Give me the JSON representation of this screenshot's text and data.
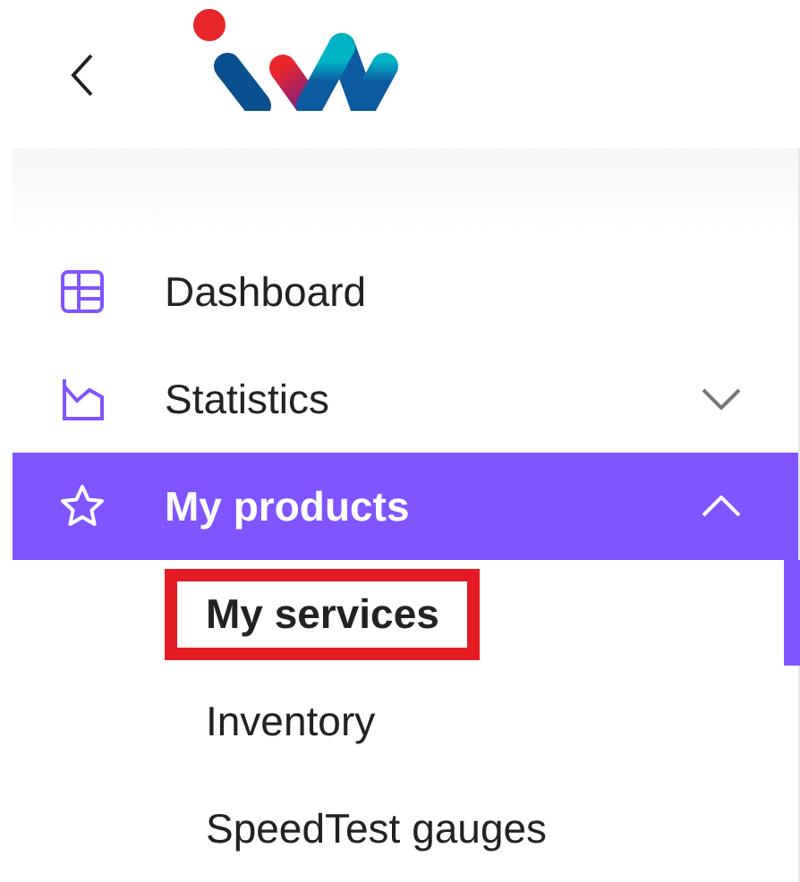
{
  "menu": [
    {
      "label": "Dashboard",
      "kind": "dashboard",
      "selected": false
    },
    {
      "label": "Statistics",
      "kind": "chart",
      "selected": false,
      "expanded": false
    },
    {
      "label": "My products",
      "kind": "star",
      "selected": true,
      "expanded": true,
      "children": [
        {
          "label": "My services",
          "selected": true,
          "highlighted": true
        },
        {
          "label": "Inventory",
          "selected": false,
          "highlighted": false
        },
        {
          "label": "SpeedTest gauges",
          "selected": false,
          "highlighted": false
        }
      ]
    }
  ]
}
